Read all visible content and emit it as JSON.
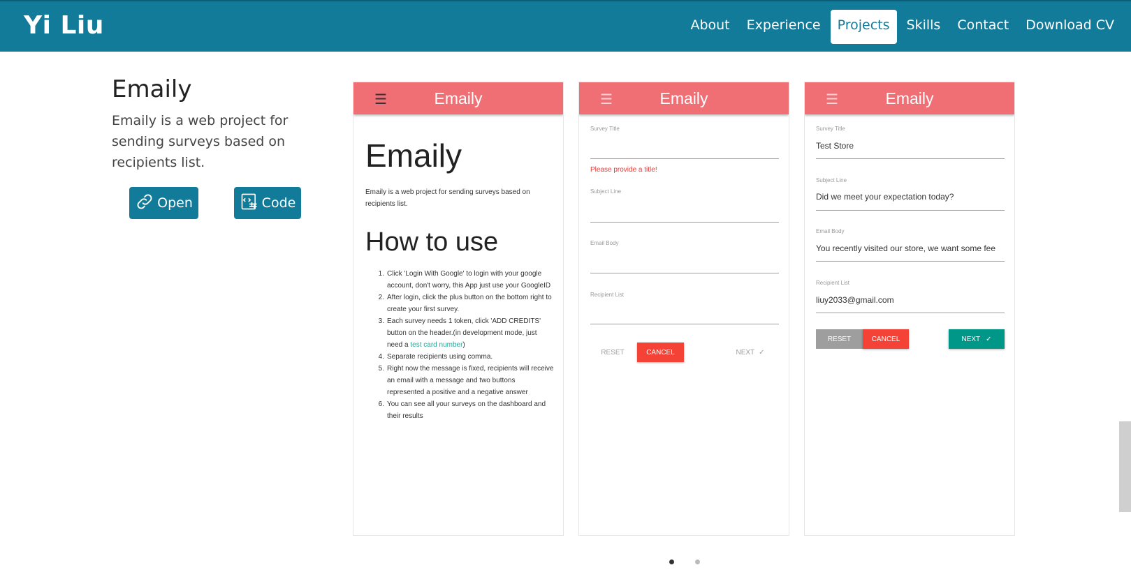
{
  "brand": "Yi Liu",
  "nav": [
    {
      "label": "About"
    },
    {
      "label": "Experience"
    },
    {
      "label": "Projects"
    },
    {
      "label": "Skills"
    },
    {
      "label": "Contact"
    },
    {
      "label": "Download CV"
    }
  ],
  "project": {
    "title": "Emaily",
    "description": "Emaily is a web project for sending surveys based on recipients list.",
    "open_label": "Open",
    "code_label": "Code"
  },
  "phone1": {
    "appbar_title": "Emaily",
    "heading": "Emaily",
    "desc": "Emaily is a web project for sending surveys based on recipients list.",
    "howto": "How to use",
    "steps": [
      {
        "num": "1.",
        "text": "Click 'Login With Google' to login with your google account, don't worry, this App just use your GoogleID"
      },
      {
        "num": "2.",
        "text": "After login, click the plus button on the bottom right to create your first survey."
      },
      {
        "num": "3.",
        "text": "Each survey needs 1 token, click 'ADD CREDITS' button on the header.(in development mode, just need a ",
        "link": "test card number",
        "after": ")"
      },
      {
        "num": "4.",
        "text": "Separate recipients using comma."
      },
      {
        "num": "5.",
        "text": "Right now the message is fixed, recipients will receive an email with a message and two buttons represented a positive and a negative answer"
      },
      {
        "num": "6.",
        "text": "You can see all your surveys on the dashboard and their results"
      }
    ]
  },
  "phone2": {
    "appbar_title": "Emaily",
    "survey_title_label": "Survey Title",
    "error": "Please provide a title!",
    "subject_label": "Subject Line",
    "body_label": "Email Body",
    "recipient_label": "Recipient List",
    "reset": "RESET",
    "cancel": "CANCEL",
    "next": "NEXT",
    "next_icon": "✓"
  },
  "phone3": {
    "appbar_title": "Emaily",
    "survey_title_label": "Survey Title",
    "survey_title_value": "Test Store",
    "subject_label": "Subject Line",
    "subject_value": "Did we meet your expectation today?",
    "body_label": "Email Body",
    "body_value": "You recently visited our store, we want some fee",
    "recipient_label": "Recipient List",
    "recipient_value": "liuy2033@gmail.com",
    "reset": "RESET",
    "cancel": "CANCEL",
    "next": "NEXT",
    "next_icon": "✓"
  },
  "colors": {
    "navbar": "#127b9a",
    "appbar": "#ef6f75",
    "teal": "#009688",
    "red": "#f44336"
  },
  "carousel": {
    "active_index": 1,
    "count": 2
  }
}
